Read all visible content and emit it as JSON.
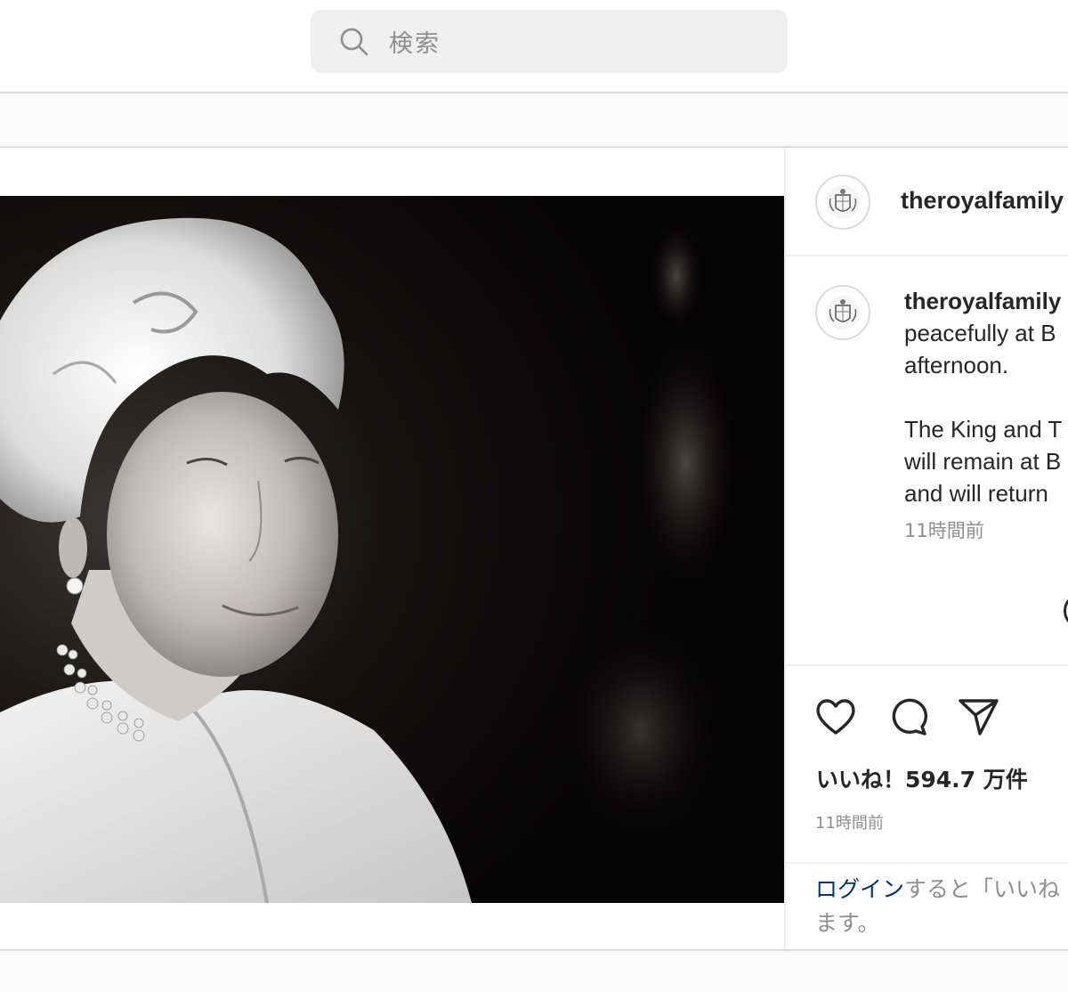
{
  "search": {
    "placeholder": "検索",
    "icon": "search-icon"
  },
  "post": {
    "photo_alt": "Black and white portrait",
    "header": {
      "username": "theroyalfamily"
    },
    "caption": {
      "username": "theroyalfamily",
      "lines": [
        "peacefully at B",
        "afternoon.",
        "",
        "The King and T",
        "will remain at B",
        "and will return"
      ],
      "time": "11時間前"
    },
    "actions": {
      "like_icon": "heart-icon",
      "comment_icon": "comment-icon",
      "share_icon": "share-icon"
    },
    "likes": "いいね！594.7 万件",
    "time": "11時間前",
    "login": {
      "link": "ログイン",
      "line1_rest": "すると「いいね",
      "line2": "ます。"
    }
  }
}
